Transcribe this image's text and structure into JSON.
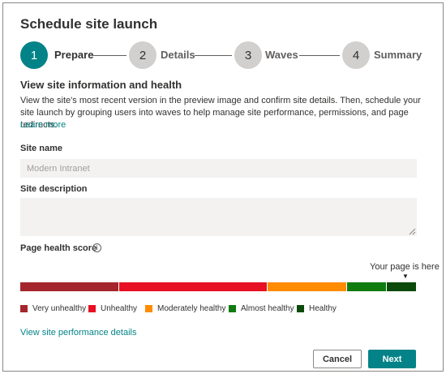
{
  "dialog": {
    "title": "Schedule site launch"
  },
  "stepper": {
    "steps": [
      {
        "number": "1",
        "label": "Prepare",
        "active": true
      },
      {
        "number": "2",
        "label": "Details",
        "active": false
      },
      {
        "number": "3",
        "label": "Waves",
        "active": false
      },
      {
        "number": "4",
        "label": "Summary",
        "active": false
      }
    ]
  },
  "section": {
    "heading": "View site information and health",
    "intro": "View the site's most recent version in the preview image and confirm site details. Then, schedule your site launch by grouping users into waves to help manage site performance, permissions, and page redirects.",
    "learn_more": "Learn more"
  },
  "form": {
    "site_name_label": "Site name",
    "site_name_value": "Modern Intranet",
    "site_description_label": "Site description",
    "site_description_value": ""
  },
  "health": {
    "label": "Page health score",
    "info_icon": "info-icon",
    "marker_text": "Your page is here",
    "marker_glyph": "▼",
    "marker_level": "Healthy",
    "bands": [
      {
        "name": "Very unhealthy",
        "color": "#a4262c"
      },
      {
        "name": "Unhealthy",
        "color": "#e81123"
      },
      {
        "name": "Moderately healthy",
        "color": "#ff8c00"
      },
      {
        "name": "Almost healthy",
        "color": "#107c10"
      },
      {
        "name": "Healthy",
        "color": "#0b4a0b"
      }
    ],
    "legend": [
      "Very unhealthy",
      "Unhealthy",
      "Moderately healthy",
      "Almost healthy",
      "Healthy"
    ]
  },
  "links": {
    "performance": "View site performance details"
  },
  "buttons": {
    "cancel": "Cancel",
    "next": "Next"
  },
  "colors": {
    "accent": "#038387"
  }
}
